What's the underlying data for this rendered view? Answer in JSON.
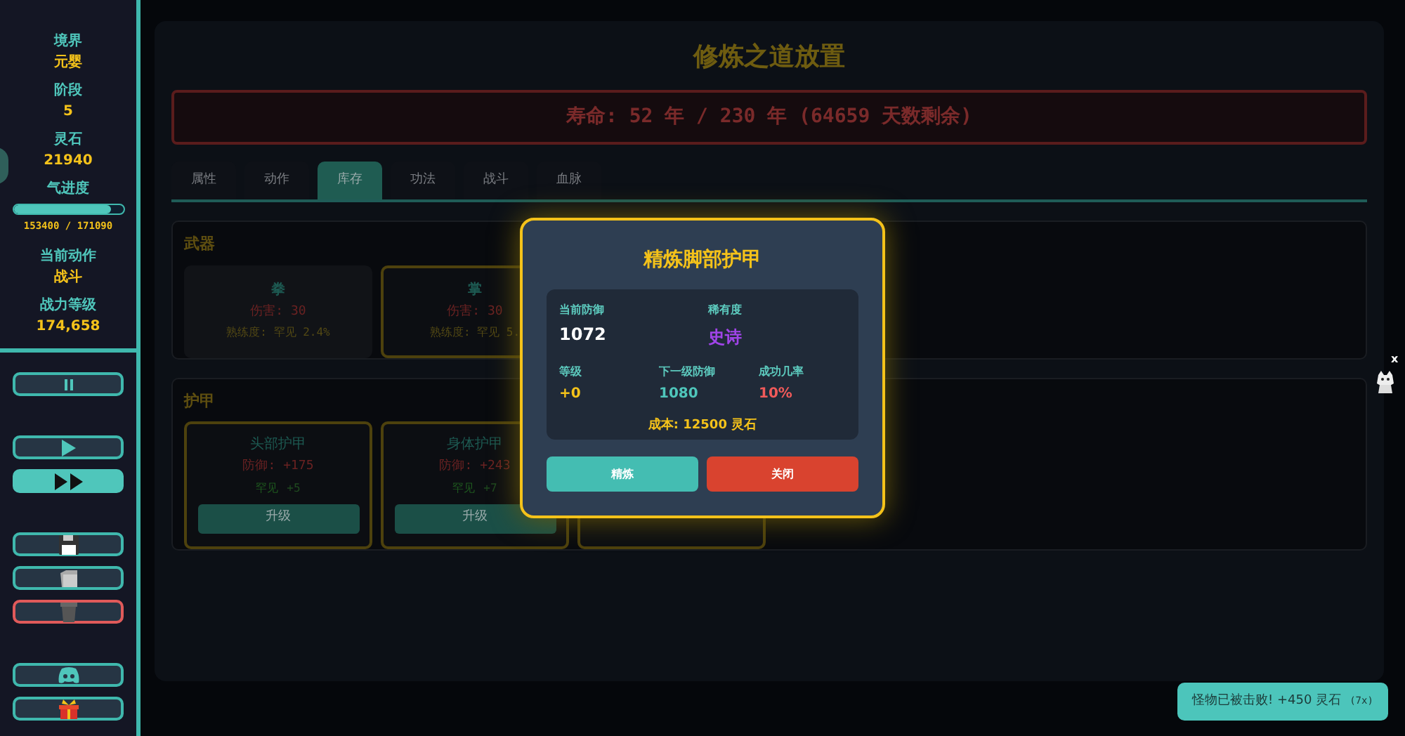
{
  "sidebar": {
    "stats": [
      {
        "label": "境界",
        "value": "元婴"
      },
      {
        "label": "阶段",
        "value": "5"
      },
      {
        "label": "灵石",
        "value": "21940"
      },
      {
        "label": "气进度",
        "kind": "progress",
        "level": 0.897,
        "reading": "153400 / 171090"
      },
      {
        "label": "当前动作",
        "value": "战斗"
      },
      {
        "label": "战力等级",
        "value": "174,658"
      }
    ],
    "button_groups": [
      [
        {
          "kind": "pause",
          "selected": false,
          "danger": false
        }
      ],
      [
        {
          "kind": "play",
          "selected": false,
          "danger": false
        },
        {
          "kind": "fast",
          "selected": true,
          "danger": false
        }
      ],
      [
        {
          "kind": "save",
          "selected": false,
          "danger": false
        },
        {
          "kind": "load",
          "selected": false,
          "danger": false
        },
        {
          "kind": "delete",
          "selected": false,
          "danger": true
        }
      ],
      [
        {
          "kind": "discord",
          "selected": false,
          "danger": false
        },
        {
          "kind": "gift",
          "selected": false,
          "danger": false
        }
      ]
    ]
  },
  "main": {
    "title": "修炼之道放置",
    "lifespan": "寿命: 52 年 / 230 年 (64659 天数剩余)",
    "tabs": [
      {
        "label": "属性",
        "selected": false
      },
      {
        "label": "动作",
        "selected": false
      },
      {
        "label": "库存",
        "selected": true
      },
      {
        "label": "功法",
        "selected": false
      },
      {
        "label": "战斗",
        "selected": false
      },
      {
        "label": "血脉",
        "selected": false
      }
    ],
    "weapons": {
      "title": "武器",
      "items": [
        {
          "name": "拳",
          "damage": "伤害: 30",
          "mastery": "熟练度: 罕见 2.4%",
          "equipped": false
        },
        {
          "name": "掌",
          "damage": "伤害: 30",
          "mastery": "熟练度: 罕见 5.",
          "equipped": true
        }
      ]
    },
    "armor": {
      "title": "护甲",
      "items": [
        {
          "name": "头部护甲",
          "defense": "防御: +175",
          "rarity": "罕见",
          "bonus": "+5",
          "button": "升级"
        },
        {
          "name": "身体护甲",
          "defense": "防御: +243",
          "rarity": "罕见",
          "bonus": "+7",
          "button": "升级"
        }
      ]
    }
  },
  "modal": {
    "title": "精炼脚部护甲",
    "current_label": "当前防御",
    "current": "1072",
    "rarity_label": "稀有度",
    "rarity": "史诗",
    "level_label": "等级",
    "level_value": "+0",
    "next_label": "下一级防御",
    "next": "1080",
    "chance_label": "成功几率",
    "chance": "10%",
    "cost": "成本: 12500 灵石",
    "buttons": [
      {
        "label": "精炼",
        "kind": "primary"
      },
      {
        "label": "关闭",
        "kind": "danger"
      }
    ]
  },
  "toast": {
    "message": "怪物已被击败! +450 灵石",
    "count": "(7x)"
  },
  "close_mark": "x"
}
